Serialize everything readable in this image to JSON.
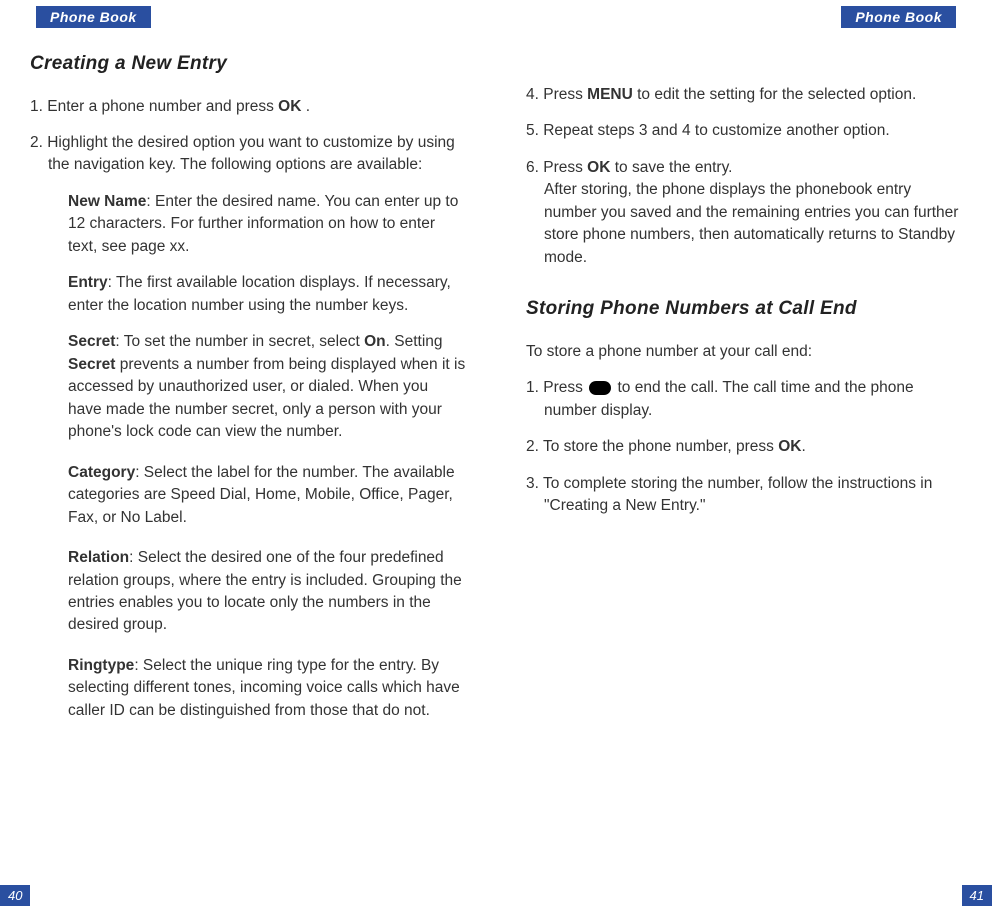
{
  "left": {
    "header": "Phone Book",
    "pageNumber": "40",
    "heading1": "Creating a New Entry",
    "step1_pre": "1. Enter a phone number and press ",
    "step1_bold": "OK",
    "step1_post": " .",
    "step2": "2. Highlight the desired option you want to customize by using the navigation key. The following options are available:",
    "opt_newname_label": "New Name",
    "opt_newname_text": ": Enter the desired name. You can enter up to 12 characters. For further information on how to enter text, see page xx.",
    "opt_entry_label": "Entry",
    "opt_entry_text": ": The first available location displays. If necessary, enter the location number using the number keys.",
    "opt_secret_label": "Secret",
    "opt_secret_text1": ": To set the number in secret, select ",
    "opt_secret_on": "On",
    "opt_secret_text2": ". Setting ",
    "opt_secret_bold": "Secret",
    "opt_secret_text3": " prevents a number from being displayed when it is accessed by unauthorized user, or dialed. When you have made the number secret, only a person with your phone's lock code can view the number.",
    "opt_category_label": "Category",
    "opt_category_text": ": Select the label for the number. The available categories are Speed Dial, Home, Mobile, Office, Pager, Fax, or No Label.",
    "opt_relation_label": "Relation",
    "opt_relation_text": ": Select the desired one of the four predefined relation groups, where the entry is included. Grouping the entries enables you to locate only the numbers in the desired group.",
    "opt_ringtype_label": "Ringtype",
    "opt_ringtype_text": ": Select the unique ring type for the entry. By selecting different tones, incoming voice calls which have caller ID can be distinguished from those that do not."
  },
  "right": {
    "header": "Phone Book",
    "pageNumber": "41",
    "step4_pre": "4. Press ",
    "step4_bold": "MENU",
    "step4_post": " to edit the setting for the selected option.",
    "step5": "5. Repeat steps 3 and 4 to customize another option.",
    "step6_pre": "6. Press ",
    "step6_bold": "OK",
    "step6_post": " to save the entry.",
    "step6_body": "After storing, the phone displays the phonebook entry number you saved and the remaining entries you can further store phone numbers, then automatically returns to Standby mode.",
    "heading2": "Storing Phone Numbers at Call End",
    "intro": "To store a phone number at your call end:",
    "r_step1_pre": "1. Press ",
    "r_step1_post": " to end the call. The call time and the phone number display.",
    "r_step2_pre": "2. To store the phone number, press ",
    "r_step2_bold": "OK",
    "r_step2_post": ".",
    "r_step3": "3. To complete storing the number, follow the instructions in \"Creating a New Entry.\""
  }
}
